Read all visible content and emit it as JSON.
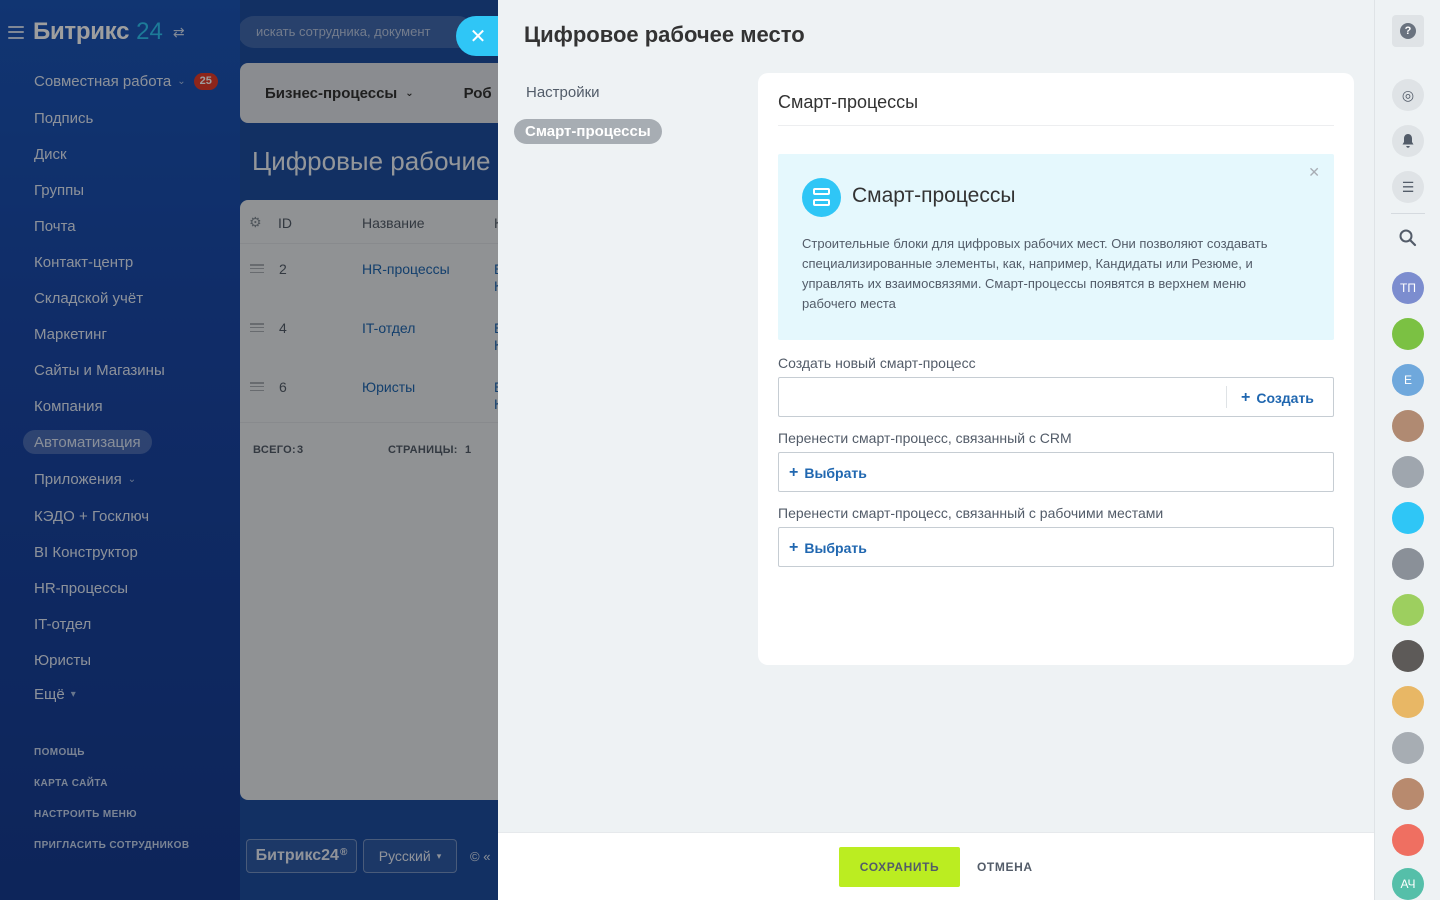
{
  "sidebar": {
    "brand_name": "Битрикс",
    "brand_num": "24",
    "items": [
      {
        "label": "Совместная работа",
        "badge": "25"
      },
      {
        "label": "Подпись"
      },
      {
        "label": "Диск"
      },
      {
        "label": "Группы"
      },
      {
        "label": "Почта"
      },
      {
        "label": "Контакт-центр"
      },
      {
        "label": "Складской учёт"
      },
      {
        "label": "Маркетинг"
      },
      {
        "label": "Сайты и Магазины"
      },
      {
        "label": "Компания"
      },
      {
        "label": "Автоматизация"
      },
      {
        "label": "Приложения"
      },
      {
        "label": "КЭДО + Госключ"
      },
      {
        "label": "BI Конструктор"
      },
      {
        "label": "HR-процессы"
      },
      {
        "label": "IT-отдел"
      },
      {
        "label": "Юристы"
      },
      {
        "label": "Ещё"
      }
    ],
    "system_links": [
      "ПОМОЩЬ",
      "КАРТА САЙТА",
      "НАСТРОИТЬ МЕНЮ",
      "ПРИГЛАСИТЬ СОТРУДНИКОВ"
    ]
  },
  "background": {
    "search_placeholder": "искать сотрудника, документ",
    "tab_bp": "Бизнес-процессы",
    "tab_rob": "Роб",
    "page_title": "Цифровые рабочие м",
    "grid_headers": {
      "id": "ID",
      "name": "Название",
      "extra": "К"
    },
    "rows": [
      {
        "id": "2",
        "name": "HR-процессы",
        "extra1": "Б",
        "extra2": "К"
      },
      {
        "id": "4",
        "name": "IT-отдел",
        "extra1": "Б",
        "extra2": "К"
      },
      {
        "id": "6",
        "name": "Юристы",
        "extra1": "Б",
        "extra2": "К"
      }
    ],
    "total_label": "ВСЕГО:",
    "total_value": "3",
    "pages_label": "СТРАНИЦЫ:",
    "pages_value": "1",
    "footer_logo": "Битрикс24",
    "footer_lang": "Русский",
    "footer_copy": "© «"
  },
  "slider": {
    "title": "Цифровое рабочее место",
    "nav": [
      "Настройки",
      "Смарт-процессы"
    ],
    "card_title": "Смарт-процессы",
    "info": {
      "title": "Смарт-процессы",
      "text": "Строительные блоки для цифровых рабочих мест. Они позволяют создавать специализированные элементы, как, например, Кандидаты или Резюме, и управлять их взаимосвязями. Смарт-процессы появятся в верхнем меню рабочего места"
    },
    "create_label": "Создать новый смарт-процесс",
    "create_btn": "Создать",
    "crm_label": "Перенести смарт-процесс, связанный с CRM",
    "crm_btn": "Выбрать",
    "ws_label": "Перенести смарт-процесс, связанный с рабочими местами",
    "ws_btn": "Выбрать",
    "save_label": "СОХРАНИТЬ",
    "cancel_label": "ОТМЕНА"
  },
  "rail": {
    "avatars": [
      {
        "initials": "ТП",
        "color": "#7c8dcf"
      },
      {
        "initials": "",
        "color": "#7bc143"
      },
      {
        "initials": "Е",
        "color": "#6fa8dc"
      },
      {
        "initials": "",
        "color": "#b08a72"
      },
      {
        "initials": "",
        "color": "#9fa6ae"
      },
      {
        "initials": "",
        "color": "#2fc6f6"
      },
      {
        "initials": "",
        "color": "#8a9098"
      },
      {
        "initials": "",
        "color": "#9dcf5f"
      },
      {
        "initials": "",
        "color": "#5d5a58"
      },
      {
        "initials": "",
        "color": "#e8b765"
      },
      {
        "initials": "",
        "color": "#a7adb3"
      },
      {
        "initials": "",
        "color": "#b88a6e"
      },
      {
        "initials": "",
        "color": "#ef6f61"
      },
      {
        "initials": "АЧ",
        "color": "#55bfa9"
      }
    ]
  }
}
